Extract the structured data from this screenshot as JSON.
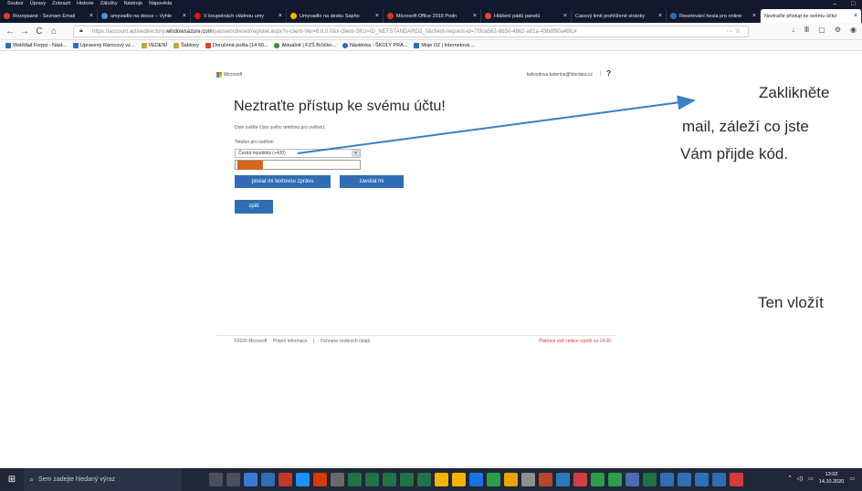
{
  "menubar": {
    "items": [
      "Soubor",
      "Úpravy",
      "Zobrazit",
      "Historie",
      "Záložky",
      "Nástroje",
      "Nápověda"
    ]
  },
  "tabs": [
    {
      "label": "Rozepsané - Seznam Email",
      "close": "×",
      "color": "#d8452a"
    },
    {
      "label": "umyvadlo na desce – Vyhle",
      "close": "×",
      "color": "#4a90d9"
    },
    {
      "label": "V koupelnách vládnou umy",
      "close": "×",
      "color": "#d81b1b"
    },
    {
      "label": "Umyvadlo na desku Sapho",
      "close": "×",
      "color": "#f0b400"
    },
    {
      "label": "Microsoft Office 2016 Podn",
      "close": "×",
      "color": "#d83b01"
    },
    {
      "label": "Hlášení pádů panelů",
      "close": "×",
      "color": "#e0463c"
    },
    {
      "label": "Časový limit prohlížené stránky",
      "close": "×",
      "color": "#5c6a80"
    },
    {
      "label": "Resetování hesla pro online",
      "close": "×",
      "color": "#2f6db5"
    },
    {
      "label": "Neztraťte přístup ke svému účtu!",
      "close": "×",
      "color": "#2f6db5",
      "active": true
    }
  ],
  "nav": {
    "back": "←",
    "forward": "→",
    "reload": "C",
    "home": "⌂",
    "url_prefix": "https://account.activedirectory.",
    "url_domain": "windowsazure.com",
    "url_rest": "/passwordreset/register.aspx?x-client-Ver=6.6.0.0&x-client-SKU=ID_NETSTANDARD2_0&client-request-id=7f3ca562-8650-48b2-a81a-43bdf90a46fc#",
    "url_more": "··· ☆",
    "tool_icons": [
      "↓",
      "Ⅲ",
      "▢",
      "⚙",
      "◉"
    ]
  },
  "bookmarks": [
    {
      "label": "WebMail Forpsi - Nást...",
      "color": "#2f6db5"
    },
    {
      "label": "Upravený Rámcový vz...",
      "color": "#2f6db5"
    },
    {
      "label": "VEDENÍ",
      "color": "#c8a14a"
    },
    {
      "label": "Šablony",
      "color": "#c8a14a"
    },
    {
      "label": "Doručená pošta (14 60...",
      "color": "#d8452a"
    },
    {
      "label": "Aktuálně | FZŠ Brůčko...",
      "color": "#3a8c3a"
    },
    {
      "label": "Nástěnka - ŠKOLY PRA...",
      "color": "#2f6db5"
    },
    {
      "label": "Moje O2 | Internetová ...",
      "color": "#2f6db5"
    }
  ],
  "ms": {
    "brand": "Microsoft",
    "user_email": "kalivodova.katerina@fzbrdata.cz",
    "separator": "|",
    "help": "?"
  },
  "panel": {
    "title": "Neztraťte přístup ke svému účtu!",
    "description": "Dole ověřte číslo svého telefonu pro ověření.",
    "phone_label": "Telefon pro ověření",
    "country_value": "Česká republika (+420)",
    "country_arrow": "▾",
    "btn_text": "poslat mi textovou zprávu",
    "btn_call": "zavolat mi",
    "btn_back": "zpět"
  },
  "footer": {
    "copyright": "©2020 Microsoft",
    "legal": "Právní informace",
    "sep": "|",
    "privacy": "Ochrana osobních údajů",
    "session_warning": "Platnost vaší relace vyprší za 14:36"
  },
  "annotations": {
    "line1": "Zaklikněte",
    "line2": "mail, záleží co jste",
    "line3": "Vám přijde kód.",
    "line4": "Ten vložít"
  },
  "taskbar": {
    "search_placeholder": "Sem zadejte hledaný výraz",
    "time": "13:02",
    "date": "14.10.2020",
    "icons": [
      "#4a4f5a",
      "#4a4f5a",
      "#3b78d8",
      "#2f6db5",
      "#c0392b",
      "#1e90ff",
      "#d83b01",
      "#6a6a6a",
      "#217346",
      "#217346",
      "#217346",
      "#217346",
      "#217346",
      "#f4b400",
      "#f4b400",
      "#1a73e8",
      "#2e9c49",
      "#e8a400",
      "#8e8e8e",
      "#b7472a",
      "#2a7ab8",
      "#d04040",
      "#2e9c49",
      "#2e9c49",
      "#4a6cb0",
      "#217346",
      "#2f6db5",
      "#2f6db5",
      "#2f6db5",
      "#2f6db5",
      "#d83a3a"
    ]
  },
  "colors": {
    "accent": "#2f6db5",
    "warning": "#d83a3a",
    "redaction": "#d5641c",
    "annotation_arrow": "#3b7fc4"
  }
}
